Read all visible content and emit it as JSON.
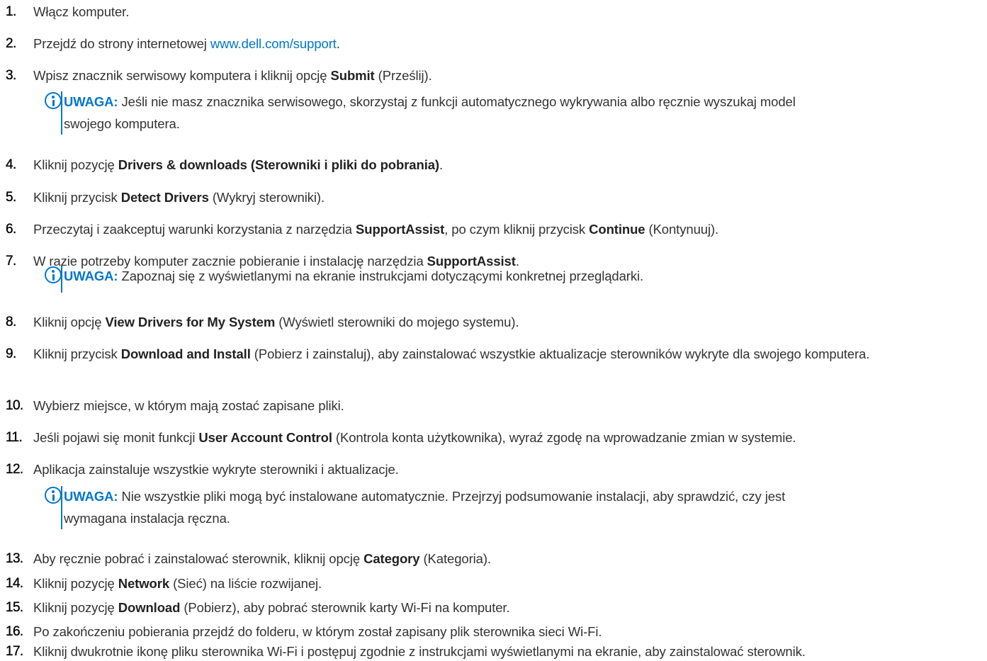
{
  "steps": [
    {
      "num": "1.",
      "text": [
        "Włącz komputer."
      ]
    },
    {
      "num": "2.",
      "text": [
        "Przejdź do strony internetowej ",
        "www.dell.com/support",
        "."
      ]
    },
    {
      "num": "3.",
      "text": [
        "Wpisz znacznik serwisowy komputera i kliknij opcję ",
        "Submit",
        " (Prześlij)."
      ]
    },
    {
      "num": "4.",
      "text": [
        "Kliknij pozycję ",
        "Drivers & downloads (Sterowniki i pliki do pobrania)",
        "."
      ]
    },
    {
      "num": "5.",
      "text": [
        "Kliknij przycisk ",
        "Detect Drivers",
        " (Wykryj sterowniki)."
      ]
    },
    {
      "num": "6.",
      "text": [
        "Przeczytaj i zaakceptuj warunki korzystania z narzędzia ",
        "SupportAssist",
        ", po czym kliknij przycisk ",
        "Continue",
        " (Kontynuuj)."
      ]
    },
    {
      "num": "7.",
      "text": [
        "W razie potrzeby komputer zacznie pobieranie i instalację narzędzia ",
        "SupportAssist",
        "."
      ]
    },
    {
      "num": "8.",
      "text": [
        "Kliknij opcję ",
        "View Drivers for My System",
        " (Wyświetl sterowniki do mojego systemu)."
      ]
    },
    {
      "num": "9.",
      "text": [
        "Kliknij przycisk ",
        "Download and Install",
        " (Pobierz i zainstaluj), aby zainstalować wszystkie aktualizacje sterowników wykryte dla swojego komputera."
      ]
    },
    {
      "num": "10.",
      "text": [
        "Wybierz miejsce, w którym mają zostać zapisane pliki."
      ]
    },
    {
      "num": "11.",
      "text": [
        "Jeśli pojawi się monit funkcji ",
        "User Account Control",
        " (Kontrola konta użytkownika), wyraź zgodę na wprowadzanie zmian w systemie."
      ]
    },
    {
      "num": "12.",
      "text": [
        "Aplikacja zainstaluje wszystkie wykryte sterowniki i aktualizacje."
      ]
    },
    {
      "num": "13.",
      "text": [
        "Aby ręcznie pobrać i zainstalować sterownik, kliknij opcję ",
        "Category",
        " (Kategoria)."
      ]
    },
    {
      "num": "14.",
      "text": [
        "Kliknij pozycję ",
        "Network",
        " (Sieć) na liście rozwijanej."
      ]
    },
    {
      "num": "15.",
      "text": [
        "Kliknij pozycję ",
        "Download",
        " (Pobierz), aby pobrać sterownik karty Wi-Fi na komputer."
      ]
    },
    {
      "num": "16.",
      "text": [
        "Po zakończeniu pobierania przejdź do folderu, w którym został zapisany plik sterownika sieci Wi-Fi."
      ]
    },
    {
      "num": "17.",
      "text": [
        "Kliknij dwukrotnie ikonę pliku sterownika Wi-Fi i postępuj zgodnie z instrukcjami wyświetlanymi na ekranie, aby zainstalować sterownik."
      ]
    }
  ],
  "notes": [
    {
      "label": "UWAGA:",
      "lines": [
        " Jeśli nie masz znacznika serwisowego, skorzystaj z funkcji automatycznego wykrywania albo ręcznie wyszukaj model",
        "swojego komputera."
      ]
    },
    {
      "label": "UWAGA:",
      "lines": [
        " Zapoznaj się z wyświetlanymi na ekranie instrukcjami dotyczącymi konkretnej przeglądarki."
      ]
    },
    {
      "label": "UWAGA:",
      "lines": [
        " Nie wszystkie pliki mogą być instalowane automatycznie. Przejrzyj podsumowanie instalacji, aby sprawdzić, czy jest",
        "wymagana instalacja ręczna."
      ]
    }
  ],
  "colors": {
    "accent": "#0076CE",
    "text": "#333333"
  }
}
